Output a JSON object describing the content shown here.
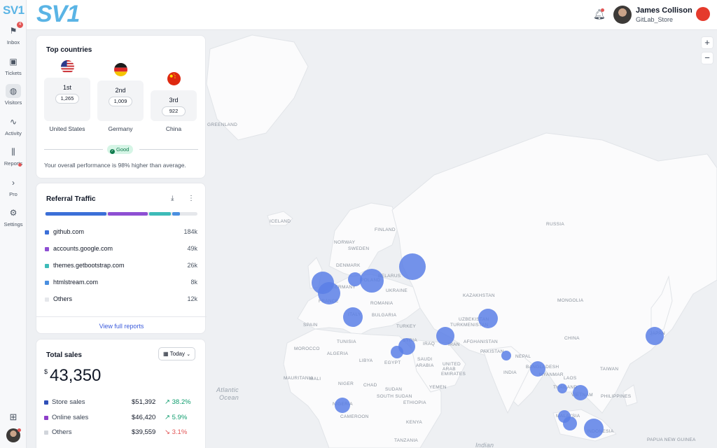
{
  "sidebar": {
    "logo": "SV1",
    "items": [
      {
        "label": "Inbox",
        "icon": "flag-icon",
        "glyph": "⚑",
        "badge": "4"
      },
      {
        "label": "Tickets",
        "icon": "ticket-icon",
        "glyph": "▣"
      },
      {
        "label": "Visitors",
        "icon": "globe-icon",
        "glyph": "◍"
      },
      {
        "label": "Activity",
        "icon": "activity-icon",
        "glyph": "∿"
      },
      {
        "label": "Reports",
        "icon": "bar-chart-icon",
        "glyph": "⫼"
      },
      {
        "label": "Pro",
        "icon": "chevron-right-icon",
        "glyph": "›"
      },
      {
        "label": "Settings",
        "icon": "sliders-icon",
        "glyph": "⚙"
      }
    ]
  },
  "header": {
    "brand": "SV1",
    "user_name": "James Collison",
    "user_store": "GitLab_Store",
    "accent": "#5ab4e5",
    "record_color": "#e53a2c"
  },
  "map": {
    "zoom_in": "+",
    "zoom_out": "−",
    "labels": [
      {
        "text": "GREENLAND"
      },
      {
        "text": "ICELAND"
      },
      {
        "text": "FINLAND"
      },
      {
        "text": "NORWAY"
      },
      {
        "text": "SWEDEN"
      },
      {
        "text": "RUSSIA"
      },
      {
        "text": "DENMARK"
      },
      {
        "text": "BELARUS"
      },
      {
        "text": "UKRAINE"
      },
      {
        "text": "KAZAKHSTAN"
      },
      {
        "text": "MONGOLIA"
      },
      {
        "text": "ROMANIA"
      },
      {
        "text": "BULGARIA"
      },
      {
        "text": "SPAIN"
      },
      {
        "text": "TURKEY"
      },
      {
        "text": "UZBEKISTAN"
      },
      {
        "text": "TURKMENISTAN"
      },
      {
        "text": "CHINA"
      },
      {
        "text": "SYRIA"
      },
      {
        "text": "IRAQ"
      },
      {
        "text": "IRAN"
      },
      {
        "text": "AFGHANISTAN"
      },
      {
        "text": "PAKISTAN"
      },
      {
        "text": "NEPAL"
      },
      {
        "text": "JAPAN"
      },
      {
        "text": "TAIWAN"
      },
      {
        "text": "MOROCCO"
      },
      {
        "text": "ALGERIA"
      },
      {
        "text": "TUNISIA"
      },
      {
        "text": "LIBYA"
      },
      {
        "text": "EGYPT"
      },
      {
        "text": "SAUDI"
      },
      {
        "text": "ARABIA"
      },
      {
        "text": "UNITED"
      },
      {
        "text": "ARAB"
      },
      {
        "text": "EMIRATES"
      },
      {
        "text": "INDIA"
      },
      {
        "text": "BANGLADESH"
      },
      {
        "text": "MYANMAR"
      },
      {
        "text": "LAOS"
      },
      {
        "text": "THAILAND"
      },
      {
        "text": "VIETNAM"
      },
      {
        "text": "PHILIPPINES"
      },
      {
        "text": "MAURITANIA"
      },
      {
        "text": "MALI"
      },
      {
        "text": "NIGER"
      },
      {
        "text": "CHAD"
      },
      {
        "text": "SUDAN"
      },
      {
        "text": "YEMEN"
      },
      {
        "text": "NIGERIA"
      },
      {
        "text": "ETHIOPIA"
      },
      {
        "text": "SOUTH SUDAN"
      },
      {
        "text": "CAMEROON"
      },
      {
        "text": "KENYA"
      },
      {
        "text": "TANZANIA"
      },
      {
        "text": "MALAYSIA"
      },
      {
        "text": "INDONESIA"
      },
      {
        "text": "PAPUA NEW GUINEA"
      },
      {
        "text": "Atlantic"
      },
      {
        "text": "Ocean"
      },
      {
        "text": "Indian"
      },
      {
        "text": "FRANCE"
      },
      {
        "text": "GERMANY"
      },
      {
        "text": "POLAND"
      },
      {
        "text": "ITALY"
      }
    ]
  },
  "top_countries": {
    "title": "Top countries",
    "countries": [
      {
        "rank": "1st",
        "value": "1,265",
        "name": "United States"
      },
      {
        "rank": "2nd",
        "value": "1,009",
        "name": "Germany"
      },
      {
        "rank": "3rd",
        "value": "922",
        "name": "China"
      }
    ],
    "badge": "Good",
    "performance_text": "Your overall performance is 98% higher than average."
  },
  "referral": {
    "title": "Referral Traffic",
    "items": [
      {
        "name": "github.com",
        "value": "184k",
        "color": "#3b6fd8",
        "share": 0.41
      },
      {
        "name": "accounts.google.com",
        "value": "49k",
        "color": "#8e4fd3",
        "share": 0.27
      },
      {
        "name": "themes.getbootstrap.com",
        "value": "26k",
        "color": "#3dbbb8",
        "share": 0.15
      },
      {
        "name": "htmlstream.com",
        "value": "8k",
        "color": "#4a8fe0",
        "share": 0.06
      },
      {
        "name": "Others",
        "value": "12k",
        "color": "#e5e7eb",
        "share": 0.11
      }
    ],
    "footer_link": "View full reports"
  },
  "sales": {
    "title": "Total sales",
    "period": "Today",
    "currency": "$",
    "total": "43,350",
    "rows": [
      {
        "name": "Store sales",
        "amount": "$51,392",
        "change": "38.2%",
        "trend": "up",
        "color": "#2f4fb8"
      },
      {
        "name": "Online sales",
        "amount": "$46,420",
        "change": "5.9%",
        "trend": "up",
        "color": "#8e3fc9"
      },
      {
        "name": "Others",
        "amount": "$39,559",
        "change": "3.1%",
        "trend": "down",
        "color": "#d1d5db"
      }
    ]
  }
}
